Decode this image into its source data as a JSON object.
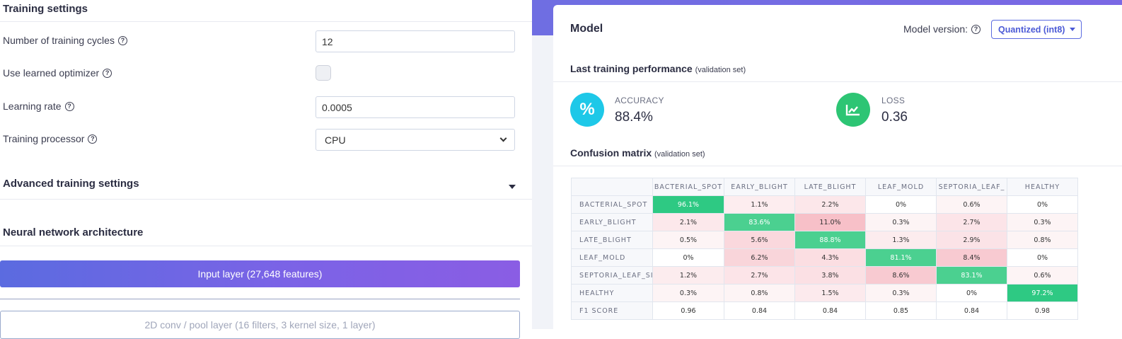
{
  "training": {
    "title": "Training settings",
    "cycles_label": "Number of training cycles",
    "cycles_value": "12",
    "optimizer_label": "Use learned optimizer",
    "lr_label": "Learning rate",
    "lr_value": "0.0005",
    "processor_label": "Training processor",
    "processor_value": "CPU",
    "help_glyph": "?"
  },
  "advanced": {
    "title": "Advanced training settings"
  },
  "architecture": {
    "title": "Neural network architecture",
    "input_layer": "Input layer (27,648 features)",
    "conv_layer": "2D conv / pool layer (16 filters, 3 kernel size, 1 layer)"
  },
  "model": {
    "title": "Model",
    "version_label": "Model version:",
    "version_value": "Quantized (int8)"
  },
  "performance": {
    "title": "Last training performance",
    "subtitle": "(validation set)",
    "accuracy_label": "ACCURACY",
    "accuracy_value": "88.4%",
    "accuracy_glyph": "%",
    "loss_label": "LOSS",
    "loss_value": "0.36"
  },
  "confusion": {
    "title": "Confusion matrix",
    "subtitle": "(validation set)",
    "columns": [
      "BACTERIAL_SPOT",
      "EARLY_BLIGHT",
      "LATE_BLIGHT",
      "LEAF_MOLD",
      "SEPTORIA_LEAF_",
      "HEALTHY"
    ],
    "rows": [
      {
        "label": "BACTERIAL_SPOT",
        "cells": [
          "96.1%",
          "1.1%",
          "2.2%",
          "0%",
          "0.6%",
          "0%"
        ]
      },
      {
        "label": "EARLY_BLIGHT",
        "cells": [
          "2.1%",
          "83.6%",
          "11.0%",
          "0.3%",
          "2.7%",
          "0.3%"
        ]
      },
      {
        "label": "LATE_BLIGHT",
        "cells": [
          "0.5%",
          "5.6%",
          "88.8%",
          "1.3%",
          "2.9%",
          "0.8%"
        ]
      },
      {
        "label": "LEAF_MOLD",
        "cells": [
          "0%",
          "6.2%",
          "4.3%",
          "81.1%",
          "8.4%",
          "0%"
        ]
      },
      {
        "label": "SEPTORIA_LEAF_SI",
        "cells": [
          "1.2%",
          "2.7%",
          "3.8%",
          "8.6%",
          "83.1%",
          "0.6%"
        ]
      },
      {
        "label": "HEALTHY",
        "cells": [
          "0.3%",
          "0.8%",
          "1.5%",
          "0.3%",
          "0%",
          "97.2%"
        ]
      },
      {
        "label": "F1 SCORE",
        "cells": [
          "0.96",
          "0.84",
          "0.84",
          "0.85",
          "0.84",
          "0.98"
        ]
      }
    ]
  },
  "colors": {
    "accent": "#5b6be0",
    "accuracy_icon": "#1ec8e8",
    "loss_icon": "#2dc574",
    "diag_cell": "#4bd090",
    "offdiag_tint": "#fbe7ea"
  }
}
